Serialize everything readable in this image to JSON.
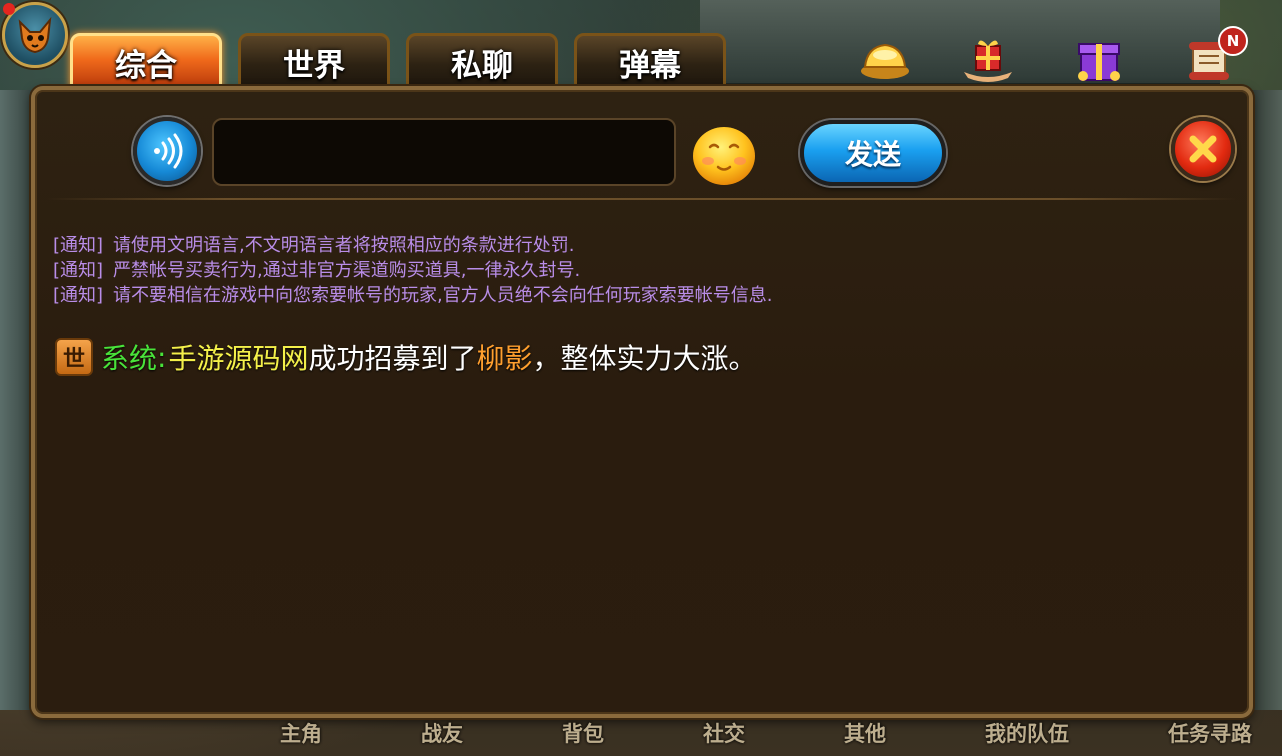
{
  "tabs": [
    {
      "label": "综合",
      "active": true
    },
    {
      "label": "世界",
      "active": false
    },
    {
      "label": "私聊",
      "active": false
    },
    {
      "label": "弹幕",
      "active": false
    }
  ],
  "top_icons": [
    "gold-ingot-icon",
    "gift-hand-icon",
    "gift-box-icon",
    "scroll-icon"
  ],
  "notification_badge": "N",
  "input": {
    "value": "",
    "placeholder": ""
  },
  "send_label": "发送",
  "notices": [
    {
      "tag": "[通知]",
      "text": "请使用文明语言,不文明语言者将按照相应的条款进行处罚."
    },
    {
      "tag": "[通知]",
      "text": "严禁帐号买卖行为,通过非官方渠道购买道具,一律永久封号."
    },
    {
      "tag": "[通知]",
      "text": "请不要相信在游戏中向您索要帐号的玩家,官方人员绝不会向任何玩家索要帐号信息."
    }
  ],
  "system_message": {
    "channel_badge": "世",
    "label": "系统",
    "colon": ":",
    "player": "手游源码网",
    "text_1": "成功招募到了",
    "hero": "柳影",
    "text_2": "，整体实力大涨。"
  },
  "bottom_nav": [
    "主角",
    "战友",
    "背包",
    "社交",
    "其他",
    "我的队伍",
    "任务寻路"
  ],
  "colors": {
    "tab_active": "#f06a1b",
    "notice_text": "#b98de8",
    "system_label": "#49e33a",
    "player_name": "#f4f04a",
    "hero_name": "#ff9f2e",
    "send_button": "#1aa0f0",
    "close_button": "#e22a10"
  }
}
